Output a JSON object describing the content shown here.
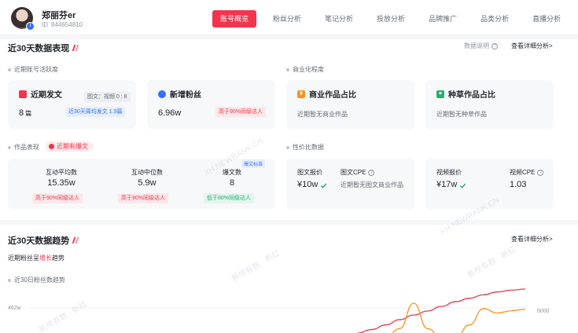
{
  "profile": {
    "name": "郑丽芬er",
    "id_label": "ID",
    "id_value": "844654810"
  },
  "tabs": [
    {
      "label": "账号概览",
      "active": true
    },
    {
      "label": "粉丝分析",
      "active": false
    },
    {
      "label": "笔记分析",
      "active": false
    },
    {
      "label": "投放分析",
      "active": false
    },
    {
      "label": "品牌推广",
      "active": false
    },
    {
      "label": "品类分析",
      "active": false
    },
    {
      "label": "直播分析",
      "active": false
    }
  ],
  "overview": {
    "title": "近30天数据表现",
    "data_note": "数据说明",
    "detail_link": "查看详细分析>",
    "activity_label": "近期账号活跃度",
    "commerce_label": "商业化程度",
    "cards": {
      "recent_posts": {
        "title": "近期发文",
        "ratio": "图文：视频 0 : 8",
        "value": "8",
        "unit": "篇",
        "tag": "近30天周均发文 1.9篇"
      },
      "new_fans": {
        "title": "新增粉丝",
        "value": "6.96w",
        "tag": "高于90%同级达人"
      },
      "commercial": {
        "title": "商业作品占比",
        "note": "近期暂无商业作品"
      },
      "seeding": {
        "title": "种草作品占比",
        "note": "近期暂无种草作品"
      }
    },
    "performance": {
      "label": "作品表现",
      "hot_badge": "近期有爆文",
      "corner_tag": "爆文标准",
      "metrics": [
        {
          "label": "互动平均数",
          "value": "15.35w",
          "tag": "高于90%同级达人",
          "tone": "red"
        },
        {
          "label": "互动中位数",
          "value": "5.9w",
          "tag": "高于90%同级达人",
          "tone": "red"
        },
        {
          "label": "爆文数",
          "value": "8",
          "tag": "低于80%同级达人",
          "tone": "green"
        }
      ]
    },
    "pricing": {
      "label": "性价比数据",
      "items": [
        {
          "label": "图文报价",
          "value": "¥10w"
        },
        {
          "label": "图文CPE",
          "note": "近期暂无图文商业作品"
        },
        {
          "label": "视频报价",
          "value": "¥17w"
        },
        {
          "label": "视频CPE",
          "value": "1.03"
        }
      ]
    }
  },
  "trend": {
    "title": "近30天数据趋势",
    "detail_link": "查看详细分析>",
    "summary_prefix": "近期粉丝呈",
    "summary_highlight": "增长",
    "summary_suffix": "趋势",
    "chart_label": "近30日粉丝数趋势",
    "y_left_tick": "462w",
    "y_right_tick": "6000",
    "colors": {
      "fans_line": "#e8394d",
      "increase_line": "#ff8f1f"
    }
  },
  "chart_data": {
    "type": "line",
    "title": "近30日粉丝数趋势",
    "y_ticks_left": [
      "462w"
    ],
    "y_ticks_right": [
      "6000"
    ],
    "series": [
      {
        "values": [
          455.0,
          455.6,
          456.4,
          457.3,
          458.1,
          458.8,
          459.6,
          460.4,
          461.0,
          461.6,
          462.1,
          462.4,
          462.6
        ]
      },
      {
        "values": [
          0,
          0,
          0,
          2500,
          9500,
          2500,
          0,
          0,
          3500,
          8000,
          6800,
          7400,
          7800
        ]
      }
    ]
  },
  "watermarks": [
    "XH.NEWRANK.CN",
    "新榜有数 · 新红",
    "XH.NEWRANK.CN",
    "新榜有数 · 新红",
    "新榜有数 · 新红"
  ]
}
